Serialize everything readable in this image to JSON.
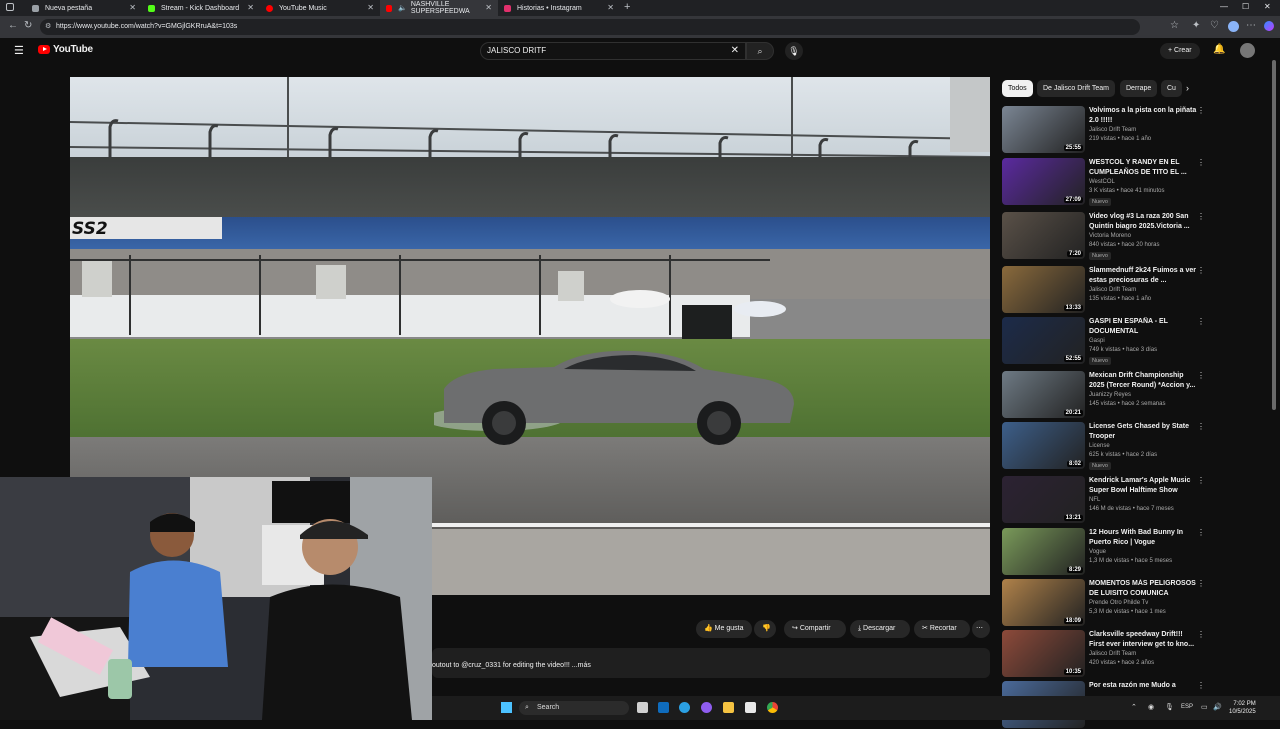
{
  "browser": {
    "tabs": [
      {
        "label": "Nueva pestaña",
        "color": "#9aa0a6"
      },
      {
        "label": "Stream - Kick Dashboard",
        "color": "#53fc18"
      },
      {
        "label": "YouTube Music",
        "color": "#ff0000"
      },
      {
        "label": "NASHVILLE SUPERSPEEDWA",
        "color": "#ff0000"
      },
      {
        "label": "Historias • Instagram",
        "color": "#e1306c"
      }
    ],
    "url": "https://www.youtube.com/watch?v=GMGjlGKRruA&t=103s"
  },
  "youtube": {
    "logo_text": "YouTube",
    "search_value": "JALISCO DRITF",
    "create_label": "Crear",
    "video_sign": "SS2"
  },
  "actions": {
    "like": "Me gusta",
    "share": "Compartir",
    "download": "Descargar",
    "clip": "Recortar"
  },
  "description": {
    "text": "outout to @cruz_0331 for editing the video!!! ...más"
  },
  "chips": [
    "Todos",
    "De Jalisco Drift Team",
    "Derrape",
    "Cu"
  ],
  "recommendations": [
    {
      "title": "Volvimos a la pista con la piñata 2.0 !!!!!",
      "channel": "Jalisco Drift Team",
      "meta": "219 vistas • hace 1 año",
      "duration": "25:55",
      "badge": "",
      "color": "#7b8694"
    },
    {
      "title": "WESTCOL Y RANDY EN EL CUMPLEAÑOS DE TITO EL ...",
      "channel": "WestCOL",
      "meta": "3 K vistas • hace 41 minutos",
      "duration": "27:09",
      "badge": "Nuevo",
      "color": "#5b2aa0"
    },
    {
      "title": "Video vlog #3 La raza 200 San Quintín biagro 2025.Victoria ...",
      "channel": "Victoria Moreno",
      "meta": "840 vistas • hace 20 horas",
      "duration": "7:20",
      "badge": "Nuevo",
      "color": "#5a5148"
    },
    {
      "title": "Slammednuff 2k24 Fuimos a ver estas preciosuras de ...",
      "channel": "Jalisco Drift Team",
      "meta": "135 vistas • hace 1 año",
      "duration": "13:33",
      "badge": "",
      "color": "#8a6a3c"
    },
    {
      "title": "GASPI EN ESPAÑA - EL DOCUMENTAL",
      "channel": "Gaspi",
      "meta": "749 k vistas • hace 3 días",
      "duration": "52:55",
      "badge": "Nuevo",
      "color": "#1c2b4a"
    },
    {
      "title": "Mexican Drift Championship 2025 (Tercer Round) *Accion y...",
      "channel": "Juanizzy Reyes",
      "meta": "145 vistas • hace 2 semanas",
      "duration": "20:21",
      "badge": "",
      "color": "#6e7a84"
    },
    {
      "title": "License Gets Chased by State Trooper",
      "channel": "License",
      "meta": "625 k vistas • hace 2 días",
      "duration": "8:02",
      "badge": "Nuevo",
      "color": "#3d5f8a"
    },
    {
      "title": "Kendrick Lamar's Apple Music Super Bowl Halftime Show",
      "channel": "NFL",
      "meta": "146 M de vistas • hace 7 meses",
      "duration": "13:21",
      "badge": "",
      "color": "#2c2233"
    },
    {
      "title": "12 Hours With Bad Bunny In Puerto Rico | Vogue",
      "channel": "Vogue",
      "meta": "1,3 M de vistas • hace 5 meses",
      "duration": "8:29",
      "badge": "",
      "color": "#7a9a5a"
    },
    {
      "title": "MOMENTOS MÁS PELIGROSOS DE LUISITO COMUNICA",
      "channel": "Prende Otro Philde Tv",
      "meta": "5,3 M de vistas • hace 1 mes",
      "duration": "18:09",
      "badge": "",
      "color": "#b0824a"
    },
    {
      "title": "Clarksville speedway Drift!!! First ever interview get to kno...",
      "channel": "Jalisco Drift Team",
      "meta": "420 vistas • hace 2 años",
      "duration": "10:35",
      "badge": "",
      "color": "#8d4a3a"
    },
    {
      "title": "Por esta razón me Mudo a",
      "channel": "",
      "meta": "",
      "duration": "",
      "badge": "",
      "color": "#4a6a9a"
    }
  ],
  "taskbar": {
    "search_label": "Search",
    "lang": "ESP",
    "time": "7:02 PM",
    "date": "10/5/2025"
  }
}
